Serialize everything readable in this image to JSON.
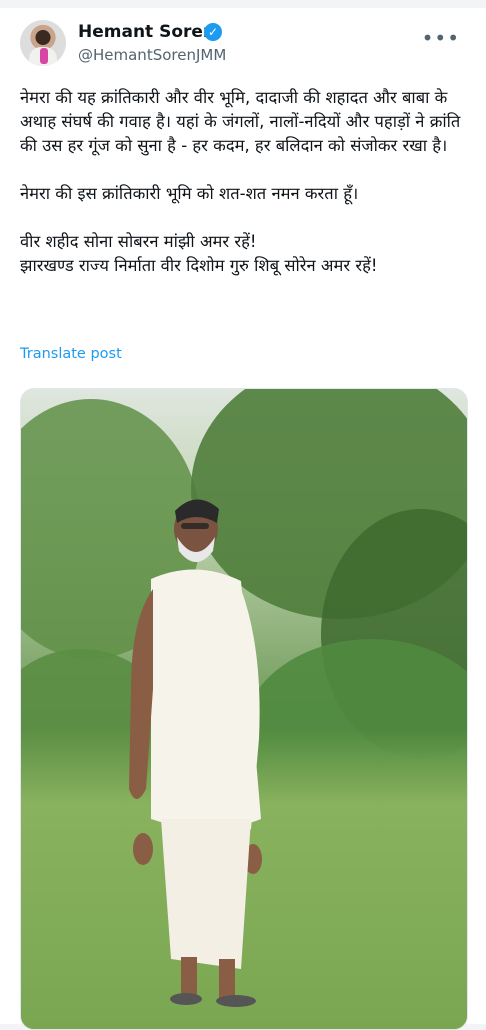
{
  "author": {
    "name": "Hemant Soren",
    "handle": "@HemantSorenJMM"
  },
  "post": {
    "paragraphs": [
      "नेमरा की यह क्रांतिकारी और वीर भूमि, दादाजी की शहादत और बाबा के अथाह संघर्ष की गवाह है। यहां के जंगलों, नालों-नदियों और पहाड़ों ने क्रांति की उस हर गूंज को सुना है - हर कदम, हर बलिदान को संजोकर रखा है।",
      "नेमरा की इस क्रांतिकारी भूमि को शत-शत नमन करता हूँ।",
      "वीर शहीद सोना सोबरन मांझी अमर रहें!",
      "झारखण्ड राज्य निर्माता वीर दिशोम गुरु शिबू सोरेन अमर रहें!"
    ],
    "translate_label": "Translate post"
  },
  "icons": {
    "verified": "verified-badge-icon",
    "more": "more-options-icon"
  },
  "colors": {
    "link": "#1d9bf0",
    "secondary_text": "#536471"
  }
}
